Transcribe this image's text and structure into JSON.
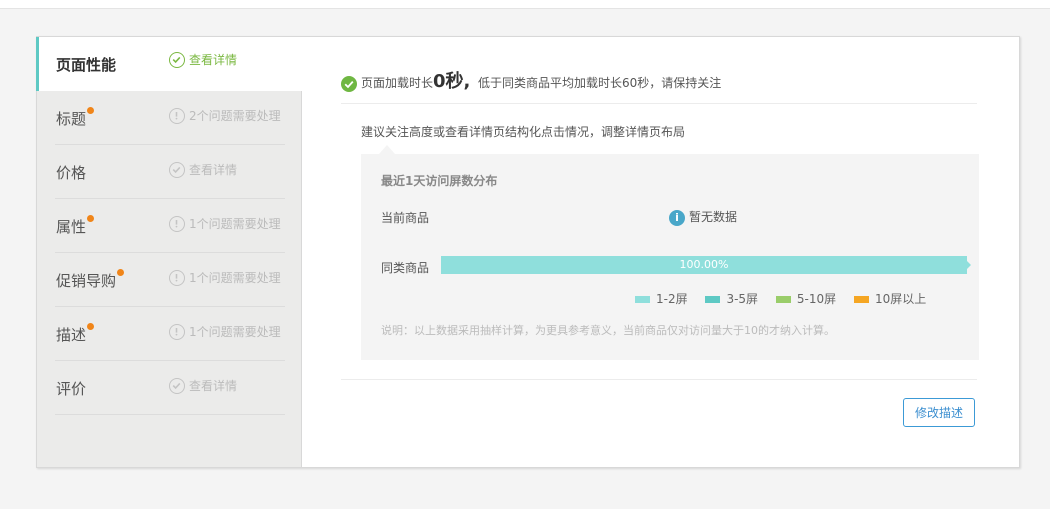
{
  "sidebar": {
    "items": [
      {
        "label": "页面性能",
        "dot": false,
        "status": "查看详情",
        "status_type": "ok",
        "active": true
      },
      {
        "label": "标题",
        "dot": true,
        "status": "2个问题需要处理",
        "status_type": "warn",
        "active": false
      },
      {
        "label": "价格",
        "dot": false,
        "status": "查看详情",
        "status_type": "ok",
        "active": false
      },
      {
        "label": "属性",
        "dot": true,
        "status": "1个问题需要处理",
        "status_type": "warn",
        "active": false
      },
      {
        "label": "促销导购",
        "dot": true,
        "status": "1个问题需要处理",
        "status_type": "warn",
        "active": false
      },
      {
        "label": "描述",
        "dot": true,
        "status": "1个问题需要处理",
        "status_type": "warn",
        "active": false
      },
      {
        "label": "评价",
        "dot": false,
        "status": "查看详情",
        "status_type": "ok",
        "active": false
      }
    ]
  },
  "main": {
    "perf_prefix": "页面加载时长",
    "perf_value": "0秒,",
    "perf_suffix": "低于同类商品平均加载时长60秒，请保持关注",
    "advice": "建议关注高度或查看详情页结构化点击情况，调整详情页布局",
    "panel": {
      "title": "最近1天访问屏数分布",
      "current_label": "当前商品",
      "no_data": "暂无数据",
      "similar_label": "同类商品",
      "bar_value": 1.0,
      "bar_label": "100.00%",
      "legend": [
        {
          "label": "1-2屏",
          "color": "#8fdfdc"
        },
        {
          "label": "3-5屏",
          "color": "#5ec9c4"
        },
        {
          "label": "5-10屏",
          "color": "#9acd6a"
        },
        {
          "label": "10屏以上",
          "color": "#f5a623"
        }
      ],
      "note": "说明：以上数据采用抽样计算，为更具参考意义，当前商品仅对访问量大于10的才纳入计算。"
    },
    "edit_button": "修改描述"
  }
}
